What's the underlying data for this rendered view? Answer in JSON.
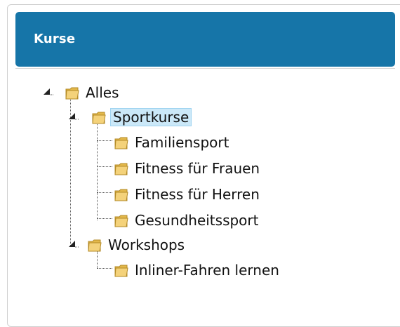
{
  "panel": {
    "title": "Kurse",
    "header_color": "#1675a8"
  },
  "tree": {
    "root": {
      "label": "Alles",
      "expanded": true,
      "children": [
        {
          "label": "Sportkurse",
          "expanded": true,
          "selected": true,
          "children": [
            {
              "label": "Familiensport"
            },
            {
              "label": "Fitness für Frauen"
            },
            {
              "label": "Fitness für Herren"
            },
            {
              "label": "Gesundheitssport"
            }
          ]
        },
        {
          "label": "Workshops",
          "expanded": true,
          "children": [
            {
              "label": "Inliner-Fahren lernen"
            }
          ]
        }
      ]
    }
  },
  "icons": {
    "folder": "folder-icon",
    "expanded": "triangle-expanded-icon"
  },
  "colors": {
    "selection_bg": "#cbe8f8",
    "folder_fill": "#f2c85b"
  }
}
